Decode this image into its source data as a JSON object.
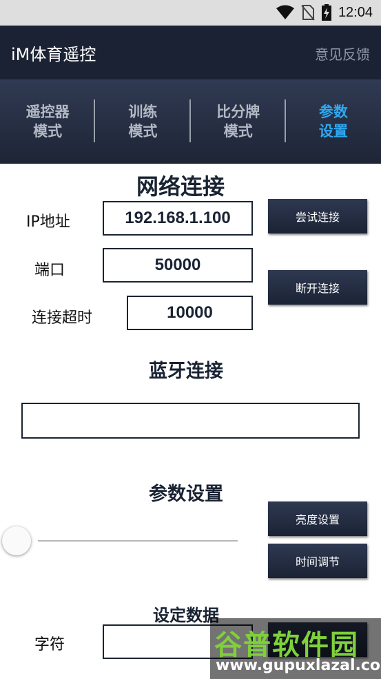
{
  "status_bar": {
    "time": "12:04"
  },
  "app_bar": {
    "title": "iM体育遥控",
    "feedback": "意见反馈"
  },
  "tabs": [
    {
      "line1": "遥控器",
      "line2": "模式",
      "active": false
    },
    {
      "line1": "训练",
      "line2": "模式",
      "active": false
    },
    {
      "line1": "比分牌",
      "line2": "模式",
      "active": false
    },
    {
      "line1": "参数",
      "line2": "设置",
      "active": true
    }
  ],
  "network": {
    "title": "网络连接",
    "ip_label": "IP地址",
    "ip_value": "192.168.1.100",
    "port_label": "端口",
    "port_value": "50000",
    "timeout_label": "连接超时",
    "timeout_value": "10000",
    "try_connect": "尝试连接",
    "disconnect": "断开连接"
  },
  "bluetooth": {
    "title": "蓝牙连接",
    "value": ""
  },
  "params": {
    "title": "参数设置",
    "brightness_button": "亮度设置",
    "time_button": "时间调节",
    "slider_value": 0
  },
  "set_data": {
    "title": "设定数据",
    "char_label": "字符",
    "char_value": ""
  },
  "watermark": {
    "big": "谷普软件园",
    "small": "www.gupuxlazal.com"
  },
  "colors": {
    "accent": "#2fa8ef",
    "dark": "#1b2233",
    "button": "#242d42"
  }
}
